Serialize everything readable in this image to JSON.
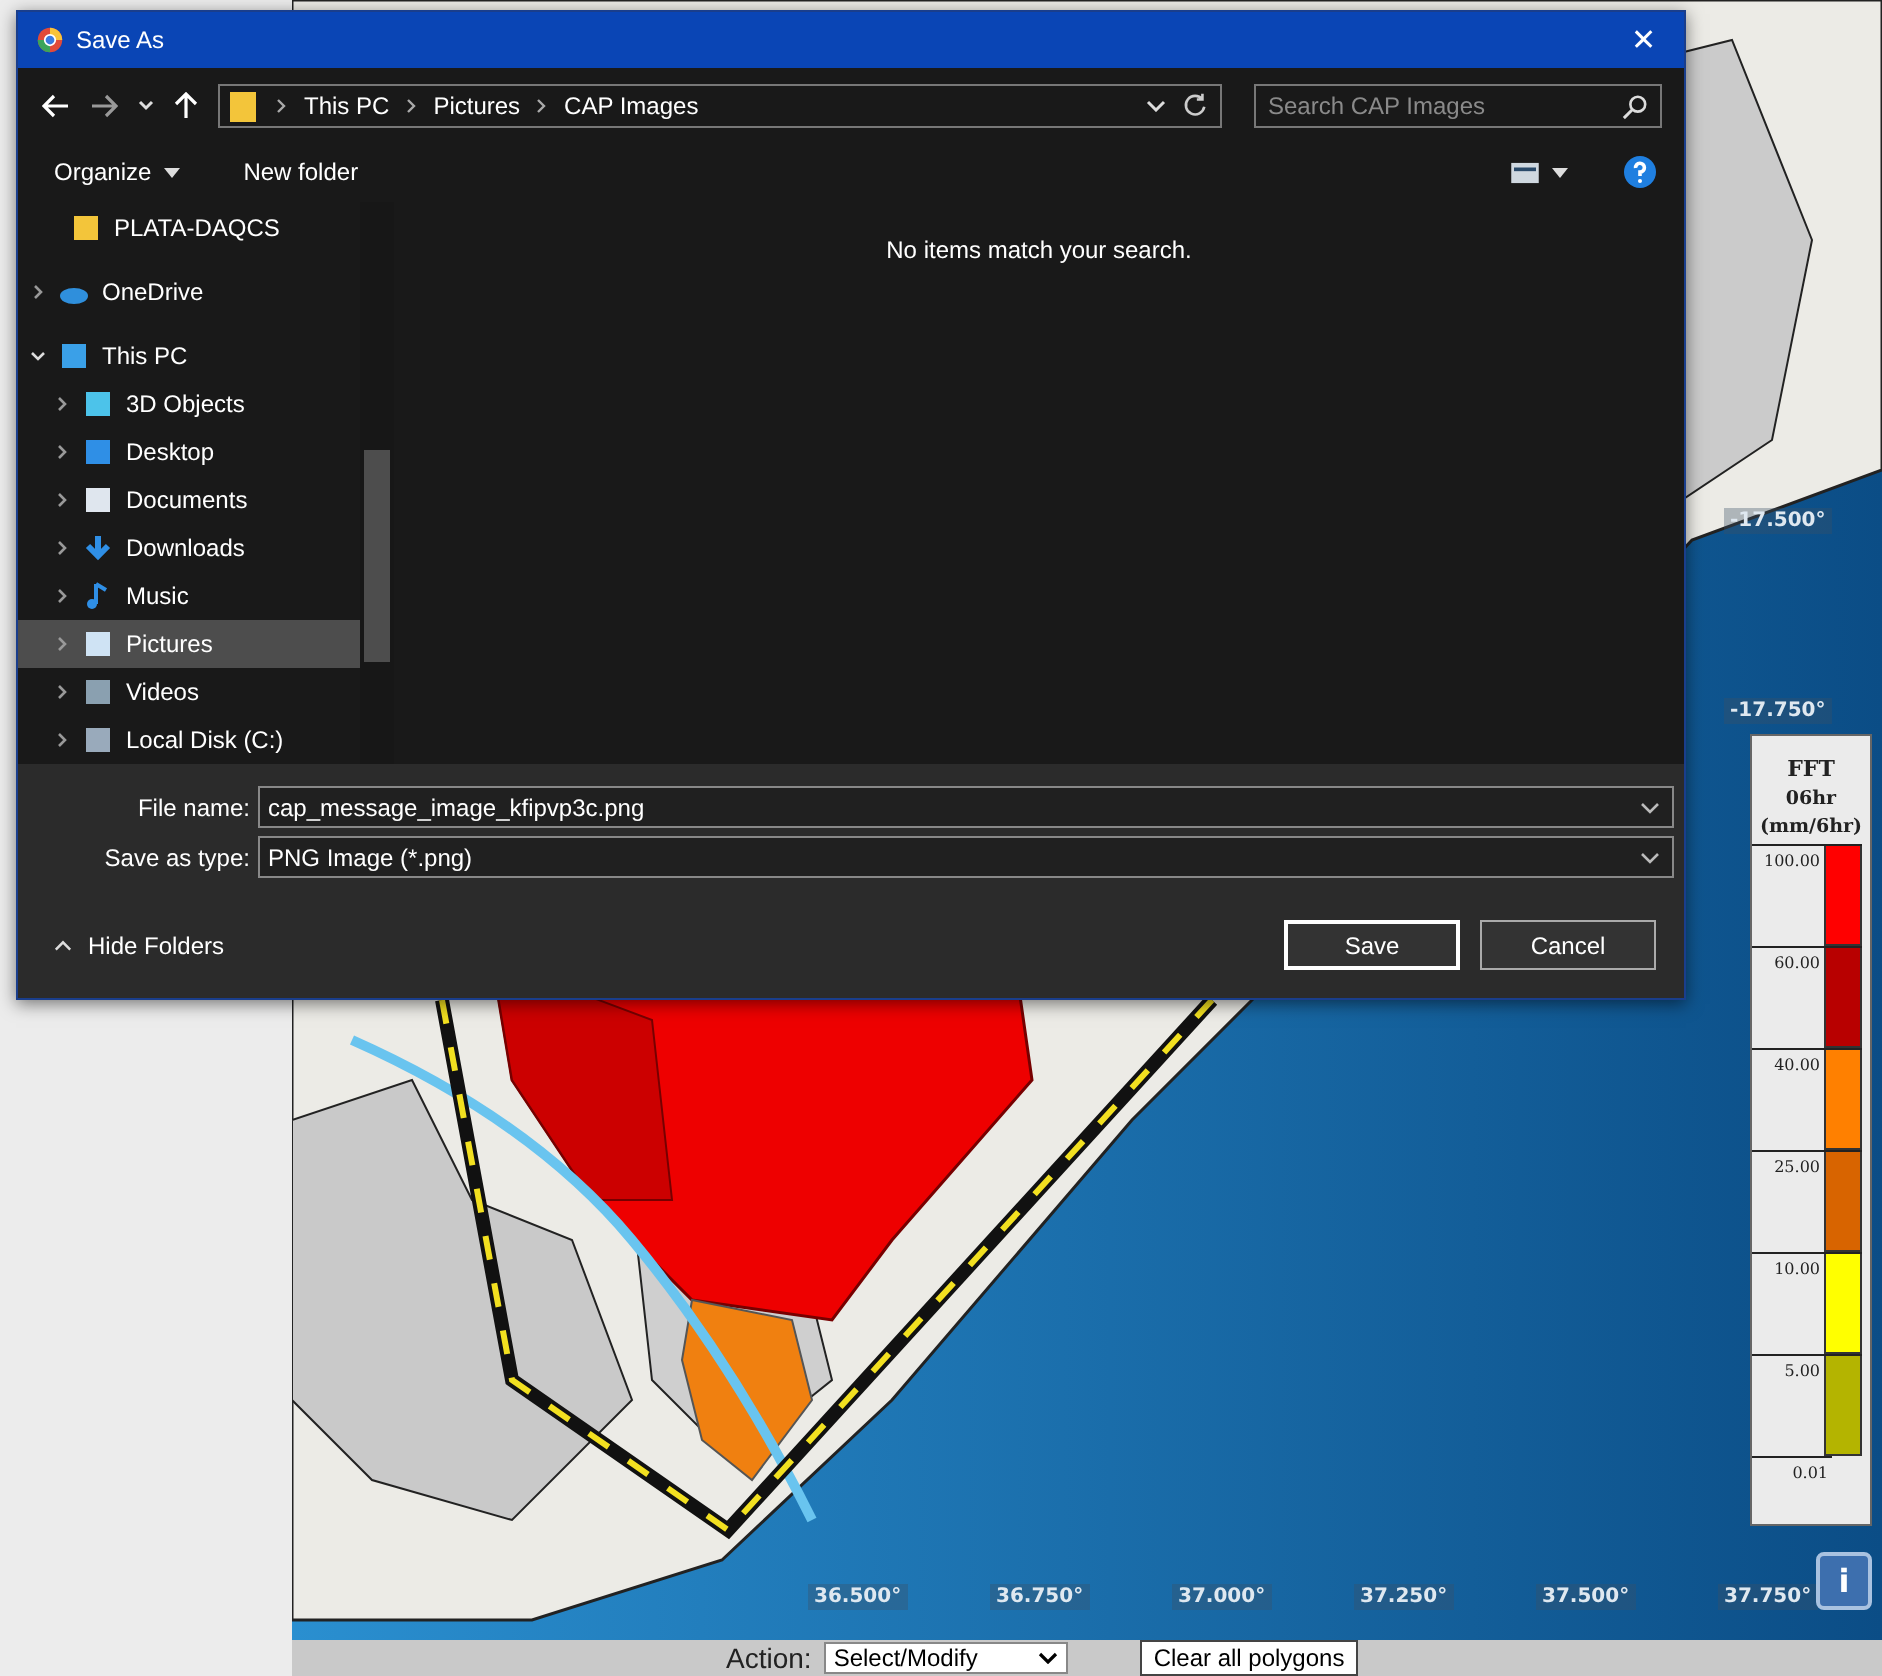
{
  "map": {
    "right_labels": [
      "-17.500°",
      "-17.750°"
    ],
    "bottom_labels": [
      "36.500°",
      "36.750°",
      "37.000°",
      "37.250°",
      "37.500°",
      "37.750°"
    ],
    "legend": {
      "title": "FFT",
      "period": "06hr",
      "unit": "(mm/6hr)",
      "bins": [
        {
          "label": "100.00",
          "color": "#ff0000"
        },
        {
          "label": "60.00",
          "color": "#b80000"
        },
        {
          "label": "40.00",
          "color": "#ff8000"
        },
        {
          "label": "25.00",
          "color": "#d86400"
        },
        {
          "label": "10.00",
          "color": "#ffff00"
        },
        {
          "label": "5.00",
          "color": "#b4b400"
        }
      ],
      "bottom_label": "0.01"
    },
    "info_button": "i"
  },
  "action_bar": {
    "label": "Action:",
    "select_value": "Select/Modify",
    "clear_button": "Clear all polygons"
  },
  "dialog": {
    "title": "Save As",
    "close": "✕",
    "breadcrumb": [
      "This PC",
      "Pictures",
      "CAP Images"
    ],
    "search": {
      "placeholder": "Search CAP Images"
    },
    "toolbar": {
      "organize": "Organize",
      "new_folder": "New folder"
    },
    "sidebar": {
      "items": [
        {
          "label": "PLATA-DAQCS",
          "kind": "folder",
          "selected": false
        },
        {
          "label": "OneDrive",
          "kind": "cloud",
          "expanded": false,
          "selected": false
        },
        {
          "label": "This PC",
          "kind": "pc",
          "expanded": true,
          "selected": false,
          "children": [
            {
              "label": "3D Objects",
              "kind": "cube",
              "expanded": false,
              "selected": false
            },
            {
              "label": "Desktop",
              "kind": "desktop",
              "expanded": false,
              "selected": false
            },
            {
              "label": "Documents",
              "kind": "document",
              "expanded": false,
              "selected": false
            },
            {
              "label": "Downloads",
              "kind": "download",
              "expanded": false,
              "selected": false
            },
            {
              "label": "Music",
              "kind": "music",
              "expanded": false,
              "selected": false
            },
            {
              "label": "Pictures",
              "kind": "pictures",
              "expanded": false,
              "selected": true
            },
            {
              "label": "Videos",
              "kind": "video",
              "expanded": false,
              "selected": false
            },
            {
              "label": "Local Disk (C:)",
              "kind": "disk",
              "expanded": false,
              "selected": false
            }
          ]
        }
      ]
    },
    "empty_message": "No items match your search.",
    "file_name": {
      "label": "File name:",
      "value": "cap_message_image_kfipvp3c.png"
    },
    "save_type": {
      "label": "Save as type:",
      "value": "PNG Image (*.png)"
    },
    "hide_folders": "Hide Folders",
    "buttons": [
      {
        "label": "Save",
        "default": true
      },
      {
        "label": "Cancel",
        "default": false
      }
    ]
  }
}
